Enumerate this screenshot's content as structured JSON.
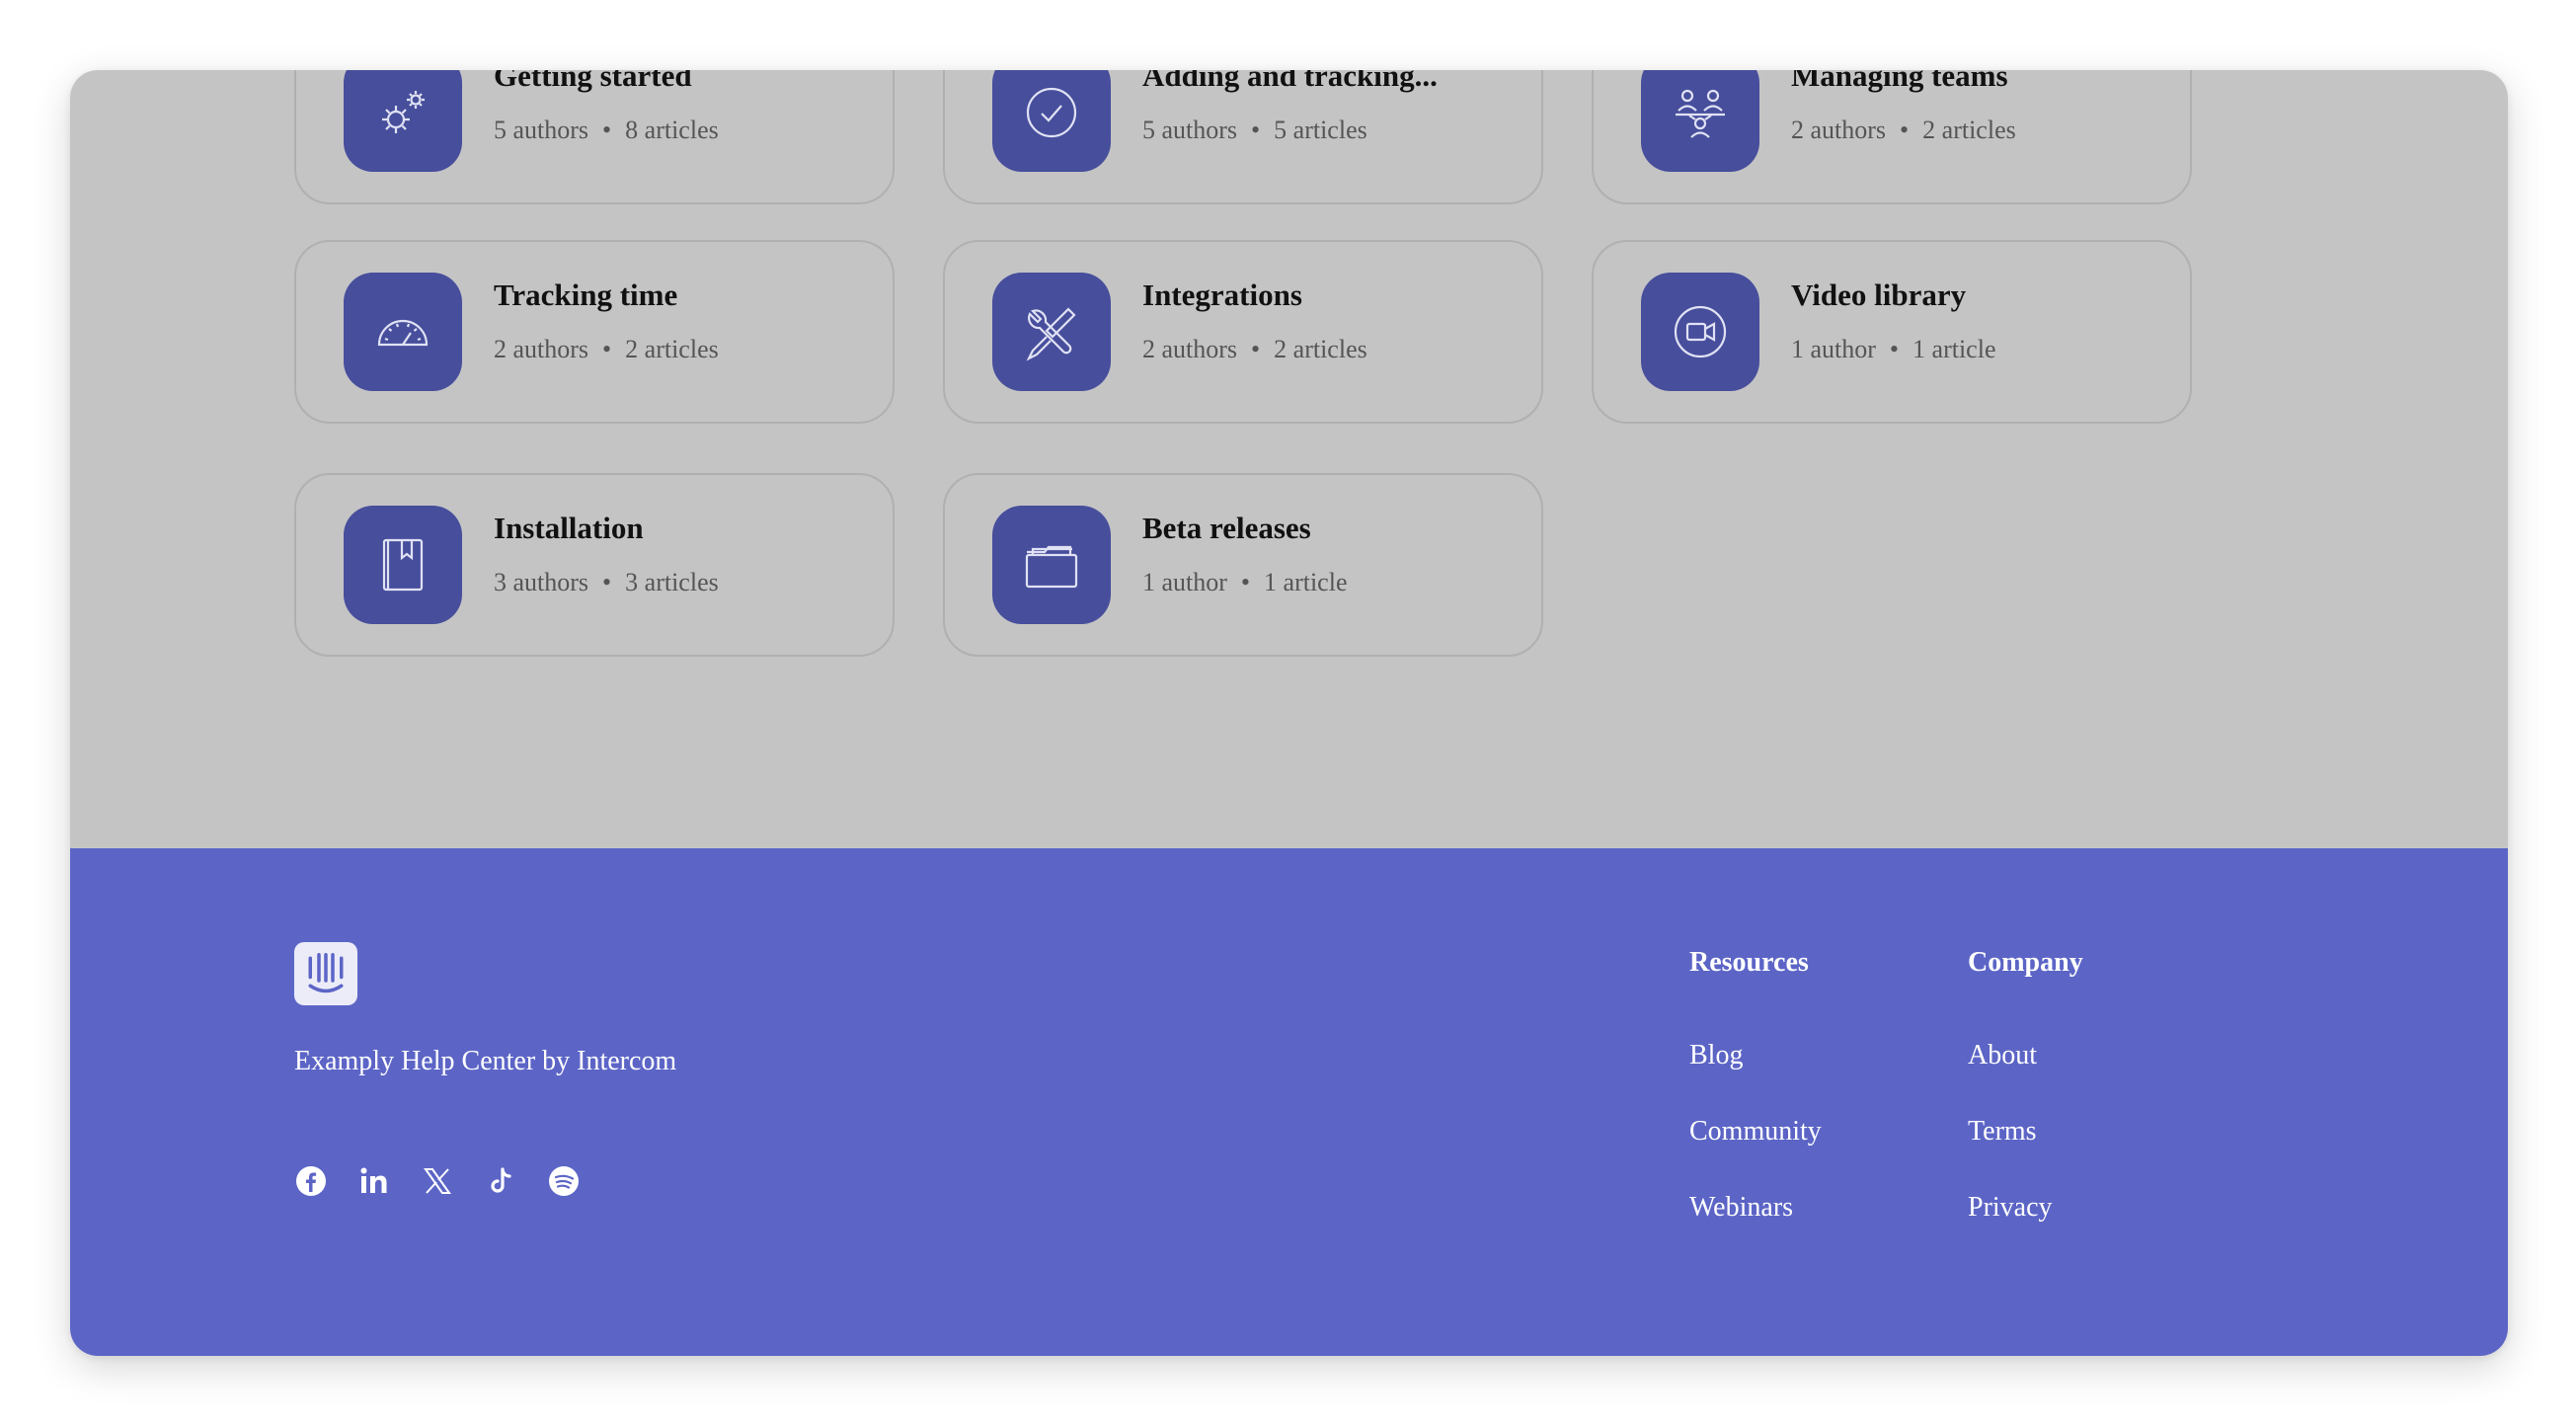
{
  "collections": [
    {
      "title": "Getting started",
      "authors": "5 authors",
      "articles": "8 articles",
      "icon": "gears-icon"
    },
    {
      "title": "Adding and tracking...",
      "authors": "5 authors",
      "articles": "5 articles",
      "icon": "check-circle-icon"
    },
    {
      "title": "Managing teams",
      "authors": "2 authors",
      "articles": "2 articles",
      "icon": "team-icon"
    },
    {
      "title": "Tracking time",
      "authors": "2 authors",
      "articles": "2 articles",
      "icon": "speedometer-icon"
    },
    {
      "title": "Integrations",
      "authors": "2 authors",
      "articles": "2 articles",
      "icon": "tools-icon"
    },
    {
      "title": "Video library",
      "authors": "1 author",
      "articles": "1 article",
      "icon": "video-camera-icon"
    },
    {
      "title": "Installation",
      "authors": "3 authors",
      "articles": "3 articles",
      "icon": "bookmark-book-icon"
    },
    {
      "title": "Beta releases",
      "authors": "1 author",
      "articles": "1 article",
      "icon": "folder-icon"
    }
  ],
  "footer": {
    "brand": "Examply Help Center by Intercom",
    "socials": [
      "facebook-icon",
      "linkedin-icon",
      "x-icon",
      "tiktok-icon",
      "spotify-icon"
    ],
    "resources": {
      "heading": "Resources",
      "links": [
        "Blog",
        "Community",
        "Webinars"
      ]
    },
    "company": {
      "heading": "Company",
      "links": [
        "About",
        "Terms",
        "Privacy"
      ]
    }
  },
  "colors": {
    "overlay": "#c4c4c4",
    "icon_box": "#474e9c",
    "footer_bg": "#5c65c6",
    "text_dark": "#111111",
    "text_meta": "#555555"
  }
}
